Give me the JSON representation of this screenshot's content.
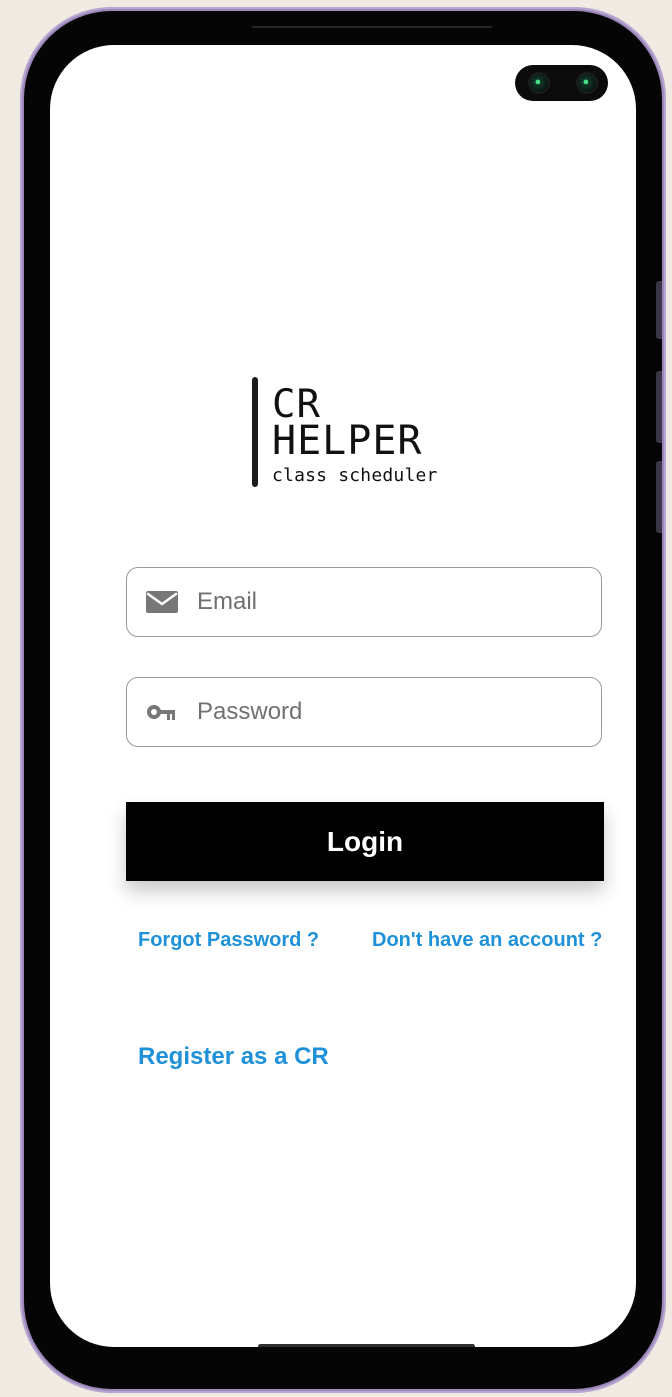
{
  "logo": {
    "line_1": "CR",
    "line_2": "HELPER",
    "line_3": "class scheduler"
  },
  "form": {
    "email_placeholder": "Email",
    "password_placeholder": "Password",
    "login_label": "Login"
  },
  "links": {
    "forgot_password": "Forgot Password ?",
    "signup": "Don't have an account ?",
    "register": "Register as a CR"
  },
  "icons": {
    "email": "mail-icon",
    "password": "key-icon"
  },
  "colors": {
    "background": "#efebe3",
    "frame": "#9a86b8",
    "screen": "#ffffff",
    "button": "#000000",
    "button_text": "#ffffff",
    "link": "#1f91d8",
    "input_border": "#9b9b9b",
    "icon": "#777777"
  }
}
